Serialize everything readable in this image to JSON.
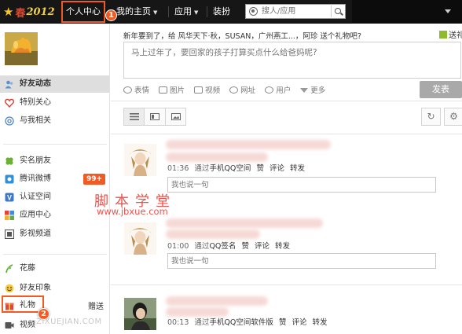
{
  "topbar": {
    "logo": {
      "chun": "春",
      "year": "2012"
    },
    "nav": [
      {
        "label": "个人中心"
      },
      {
        "label": "我的主页"
      },
      {
        "label": "应用"
      },
      {
        "label": "装扮"
      }
    ],
    "search_placeholder": "搜人/应用",
    "markers": [
      "1",
      "2"
    ]
  },
  "sidebar": {
    "items": [
      {
        "label": "好友动态",
        "icon": "friends-feed-icon",
        "active": true
      },
      {
        "label": "特别关心",
        "icon": "heart-icon"
      },
      {
        "label": "与我相关",
        "icon": "at-icon"
      },
      {
        "label": "实名朋友",
        "icon": "clover-icon"
      },
      {
        "label": "腾讯微博",
        "icon": "weibo-icon",
        "badge": "99+"
      },
      {
        "label": "认证空间",
        "icon": "verified-icon"
      },
      {
        "label": "应用中心",
        "icon": "app-grid-icon"
      },
      {
        "label": "影视频道",
        "icon": "film-icon"
      },
      {
        "label": "花藤",
        "icon": "vine-icon"
      },
      {
        "label": "好友印象",
        "icon": "smile-face-icon"
      },
      {
        "label": "礼物",
        "icon": "gift-icon"
      },
      {
        "label": "视频",
        "icon": "video-icon"
      }
    ],
    "gift_send": "赠送"
  },
  "main": {
    "birthday_notice": "新年要到了，给 风华天下·秋，SUSAN，广州燕工...，阿珍 送个礼物吧?",
    "gift_label": "送礼",
    "compose_placeholder": "马上过年了，要回家的孩子打算买点什么给爸妈呢?",
    "tools": [
      {
        "label": "表情",
        "icon": "emoji-icon"
      },
      {
        "label": "图片",
        "icon": "image-icon"
      },
      {
        "label": "视频",
        "icon": "video-tool-icon"
      },
      {
        "label": "网址",
        "icon": "link-icon"
      },
      {
        "label": "用户",
        "icon": "at-user-icon"
      },
      {
        "label": "更多",
        "icon": "more-icon"
      }
    ],
    "publish": "发表",
    "feeds": [
      {
        "time": "01:36",
        "via": "通过",
        "source": "手机QQ空间",
        "actions": [
          "赞",
          "评论",
          "转发"
        ],
        "reply_placeholder": "我也说一句"
      },
      {
        "time": "01:00",
        "via": "通过",
        "source": "QQ签名",
        "actions": [
          "赞",
          "评论",
          "转发"
        ],
        "reply_placeholder": "我也说一句"
      },
      {
        "time": "00:13",
        "via": "通过",
        "source": "手机QQ空间软件版",
        "actions": [
          "赞",
          "评论",
          "转发"
        ]
      }
    ]
  },
  "watermark": {
    "chinese": "脚本学堂",
    "url": "www.jbxue.com",
    "gray": "ZIXUEJIAN.COM"
  },
  "colors": {
    "accent": "#f05a23",
    "topbar": "#161616",
    "sidebar_active": "#dedede"
  }
}
